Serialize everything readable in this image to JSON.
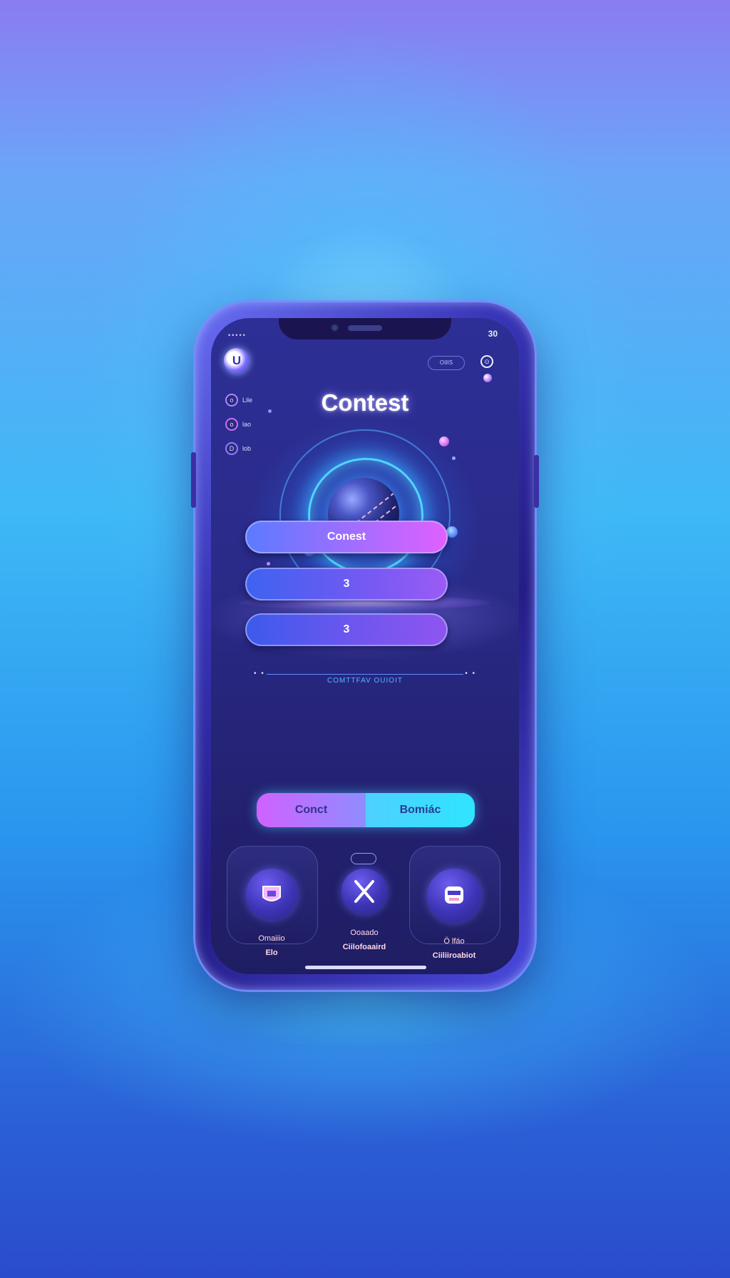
{
  "status_bar": {
    "left_dots": "•••••",
    "right_text": "30"
  },
  "header": {
    "logo_glyph": "U",
    "pill_text": "OIIIS",
    "settings_glyph": "⊙"
  },
  "side_menu": [
    {
      "glyph": "o",
      "label": "Lile"
    },
    {
      "glyph": "o",
      "label": "lao"
    },
    {
      "glyph": "D",
      "label": "lob"
    }
  ],
  "title": "Contest",
  "hero": {
    "icon": "cricket-ball-icon"
  },
  "bars": [
    {
      "label": "Conest"
    },
    {
      "label": "3"
    },
    {
      "label": "3"
    }
  ],
  "divider": {
    "caption": "COMTTFAV OUIOIT",
    "dots": "• •"
  },
  "action": {
    "left_label": "Conct",
    "right_label": "Bomiác"
  },
  "roles": [
    {
      "icon": "bowler-avatar-icon",
      "line1": "Omaiiio",
      "line2": "Elo"
    },
    {
      "icon": "crossed-bats-icon",
      "line1": "Ooaado",
      "line2": "Ciilofoaaird"
    },
    {
      "icon": "keeper-avatar-icon",
      "line1": "Ö lfáo",
      "line2": "Ciiliiroabiot"
    }
  ],
  "colors": {
    "accent_pink": "#e060ff",
    "accent_cyan": "#2fe4ff",
    "screen_bg": "#2a2a88"
  }
}
